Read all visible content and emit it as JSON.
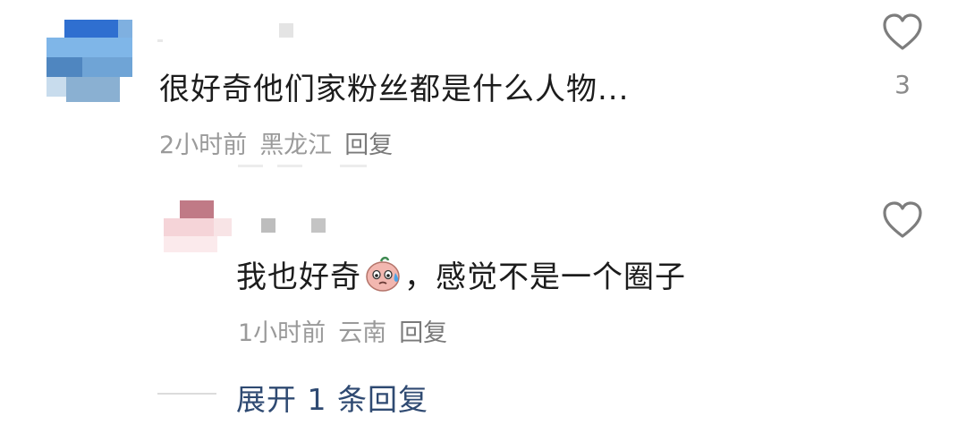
{
  "comments": [
    {
      "text": "很好奇他们家粉丝都是什么人物...",
      "time": "2小时前",
      "location": "黑龙江",
      "reply_label": "回复",
      "likes": "3",
      "avatar_icon": "pixelated-avatar-blue"
    },
    {
      "text_before": "我也好奇",
      "emoji_icon": "sweating-face-emoji",
      "text_after": "，感觉不是一个圈子",
      "time": "1小时前",
      "location": "云南",
      "reply_label": "回复",
      "likes": "",
      "avatar_icon": "pixelated-avatar-pink"
    }
  ],
  "expand_replies": "展开 1 条回复",
  "colors": {
    "text": "#1c1c1c",
    "meta": "#9a9a9a",
    "link": "#2f4a72",
    "heart": "#7d7d7d"
  }
}
